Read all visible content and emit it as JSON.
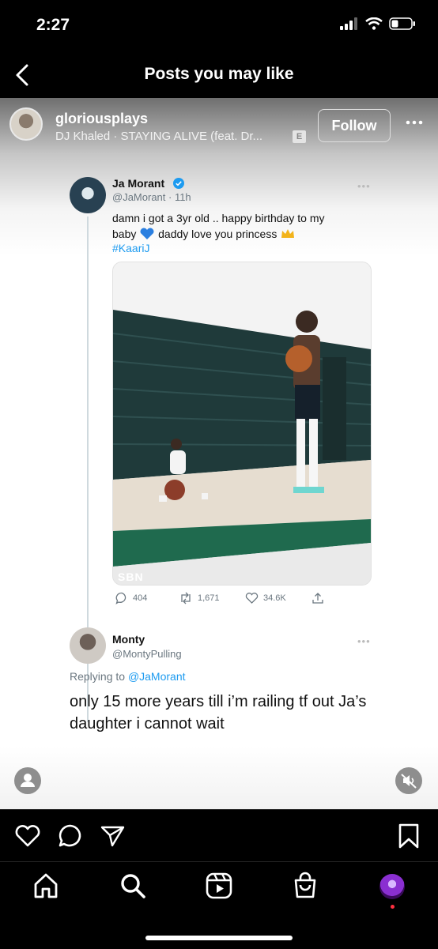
{
  "status_bar": {
    "time": "2:27"
  },
  "nav": {
    "title": "Posts you may like",
    "back_icon": "chevron-left-icon"
  },
  "post": {
    "username": "gloriousplays",
    "audio": "DJ Khaled · STAYING ALIVE (feat. Dr...",
    "explicit_badge": "E",
    "follow_label": "Follow",
    "tweet": {
      "name": "Ja Morant",
      "handle": "@JaMorant · 11h",
      "text_line1": "damn i got a 3yr old .. happy birthday to my",
      "text_line2_a": "baby",
      "text_line2_b": "daddy love you princess",
      "hashtag": "#KaariJ",
      "image_watermark": "SBN",
      "replies": "404",
      "retweets": "1,671",
      "likes": "34.6K"
    },
    "reply": {
      "name": "Monty",
      "handle": "@MontyPulling",
      "replying_prefix": "Replying to",
      "replying_mention": "@JaMorant",
      "text": "only 15 more years till i’m railing tf out Ja’s daughter i cannot wait"
    }
  },
  "colors": {
    "link": "#1d9bf0",
    "background": "#000000",
    "notification_dot": "#ff3040"
  }
}
